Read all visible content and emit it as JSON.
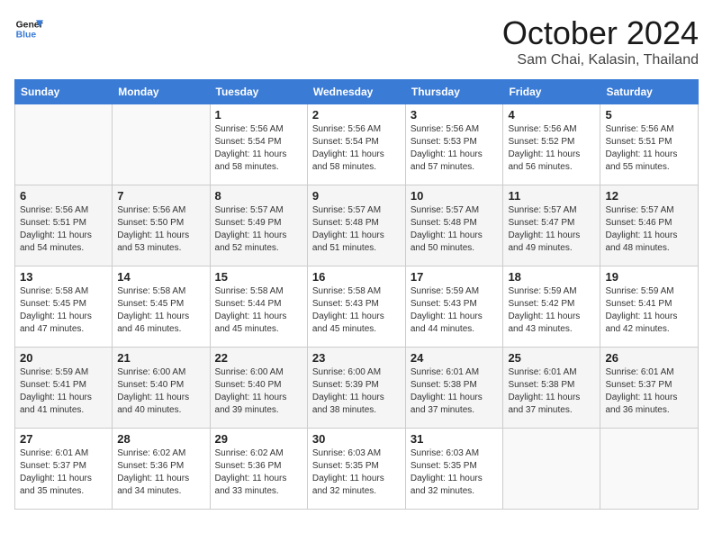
{
  "header": {
    "logo_line1": "General",
    "logo_line2": "Blue",
    "month": "October 2024",
    "location": "Sam Chai, Kalasin, Thailand"
  },
  "days_of_week": [
    "Sunday",
    "Monday",
    "Tuesday",
    "Wednesday",
    "Thursday",
    "Friday",
    "Saturday"
  ],
  "weeks": [
    [
      {
        "day": "",
        "info": ""
      },
      {
        "day": "",
        "info": ""
      },
      {
        "day": "1",
        "info": "Sunrise: 5:56 AM\nSunset: 5:54 PM\nDaylight: 11 hours\nand 58 minutes."
      },
      {
        "day": "2",
        "info": "Sunrise: 5:56 AM\nSunset: 5:54 PM\nDaylight: 11 hours\nand 58 minutes."
      },
      {
        "day": "3",
        "info": "Sunrise: 5:56 AM\nSunset: 5:53 PM\nDaylight: 11 hours\nand 57 minutes."
      },
      {
        "day": "4",
        "info": "Sunrise: 5:56 AM\nSunset: 5:52 PM\nDaylight: 11 hours\nand 56 minutes."
      },
      {
        "day": "5",
        "info": "Sunrise: 5:56 AM\nSunset: 5:51 PM\nDaylight: 11 hours\nand 55 minutes."
      }
    ],
    [
      {
        "day": "6",
        "info": "Sunrise: 5:56 AM\nSunset: 5:51 PM\nDaylight: 11 hours\nand 54 minutes."
      },
      {
        "day": "7",
        "info": "Sunrise: 5:56 AM\nSunset: 5:50 PM\nDaylight: 11 hours\nand 53 minutes."
      },
      {
        "day": "8",
        "info": "Sunrise: 5:57 AM\nSunset: 5:49 PM\nDaylight: 11 hours\nand 52 minutes."
      },
      {
        "day": "9",
        "info": "Sunrise: 5:57 AM\nSunset: 5:48 PM\nDaylight: 11 hours\nand 51 minutes."
      },
      {
        "day": "10",
        "info": "Sunrise: 5:57 AM\nSunset: 5:48 PM\nDaylight: 11 hours\nand 50 minutes."
      },
      {
        "day": "11",
        "info": "Sunrise: 5:57 AM\nSunset: 5:47 PM\nDaylight: 11 hours\nand 49 minutes."
      },
      {
        "day": "12",
        "info": "Sunrise: 5:57 AM\nSunset: 5:46 PM\nDaylight: 11 hours\nand 48 minutes."
      }
    ],
    [
      {
        "day": "13",
        "info": "Sunrise: 5:58 AM\nSunset: 5:45 PM\nDaylight: 11 hours\nand 47 minutes."
      },
      {
        "day": "14",
        "info": "Sunrise: 5:58 AM\nSunset: 5:45 PM\nDaylight: 11 hours\nand 46 minutes."
      },
      {
        "day": "15",
        "info": "Sunrise: 5:58 AM\nSunset: 5:44 PM\nDaylight: 11 hours\nand 45 minutes."
      },
      {
        "day": "16",
        "info": "Sunrise: 5:58 AM\nSunset: 5:43 PM\nDaylight: 11 hours\nand 45 minutes."
      },
      {
        "day": "17",
        "info": "Sunrise: 5:59 AM\nSunset: 5:43 PM\nDaylight: 11 hours\nand 44 minutes."
      },
      {
        "day": "18",
        "info": "Sunrise: 5:59 AM\nSunset: 5:42 PM\nDaylight: 11 hours\nand 43 minutes."
      },
      {
        "day": "19",
        "info": "Sunrise: 5:59 AM\nSunset: 5:41 PM\nDaylight: 11 hours\nand 42 minutes."
      }
    ],
    [
      {
        "day": "20",
        "info": "Sunrise: 5:59 AM\nSunset: 5:41 PM\nDaylight: 11 hours\nand 41 minutes."
      },
      {
        "day": "21",
        "info": "Sunrise: 6:00 AM\nSunset: 5:40 PM\nDaylight: 11 hours\nand 40 minutes."
      },
      {
        "day": "22",
        "info": "Sunrise: 6:00 AM\nSunset: 5:40 PM\nDaylight: 11 hours\nand 39 minutes."
      },
      {
        "day": "23",
        "info": "Sunrise: 6:00 AM\nSunset: 5:39 PM\nDaylight: 11 hours\nand 38 minutes."
      },
      {
        "day": "24",
        "info": "Sunrise: 6:01 AM\nSunset: 5:38 PM\nDaylight: 11 hours\nand 37 minutes."
      },
      {
        "day": "25",
        "info": "Sunrise: 6:01 AM\nSunset: 5:38 PM\nDaylight: 11 hours\nand 37 minutes."
      },
      {
        "day": "26",
        "info": "Sunrise: 6:01 AM\nSunset: 5:37 PM\nDaylight: 11 hours\nand 36 minutes."
      }
    ],
    [
      {
        "day": "27",
        "info": "Sunrise: 6:01 AM\nSunset: 5:37 PM\nDaylight: 11 hours\nand 35 minutes."
      },
      {
        "day": "28",
        "info": "Sunrise: 6:02 AM\nSunset: 5:36 PM\nDaylight: 11 hours\nand 34 minutes."
      },
      {
        "day": "29",
        "info": "Sunrise: 6:02 AM\nSunset: 5:36 PM\nDaylight: 11 hours\nand 33 minutes."
      },
      {
        "day": "30",
        "info": "Sunrise: 6:03 AM\nSunset: 5:35 PM\nDaylight: 11 hours\nand 32 minutes."
      },
      {
        "day": "31",
        "info": "Sunrise: 6:03 AM\nSunset: 5:35 PM\nDaylight: 11 hours\nand 32 minutes."
      },
      {
        "day": "",
        "info": ""
      },
      {
        "day": "",
        "info": ""
      }
    ]
  ]
}
